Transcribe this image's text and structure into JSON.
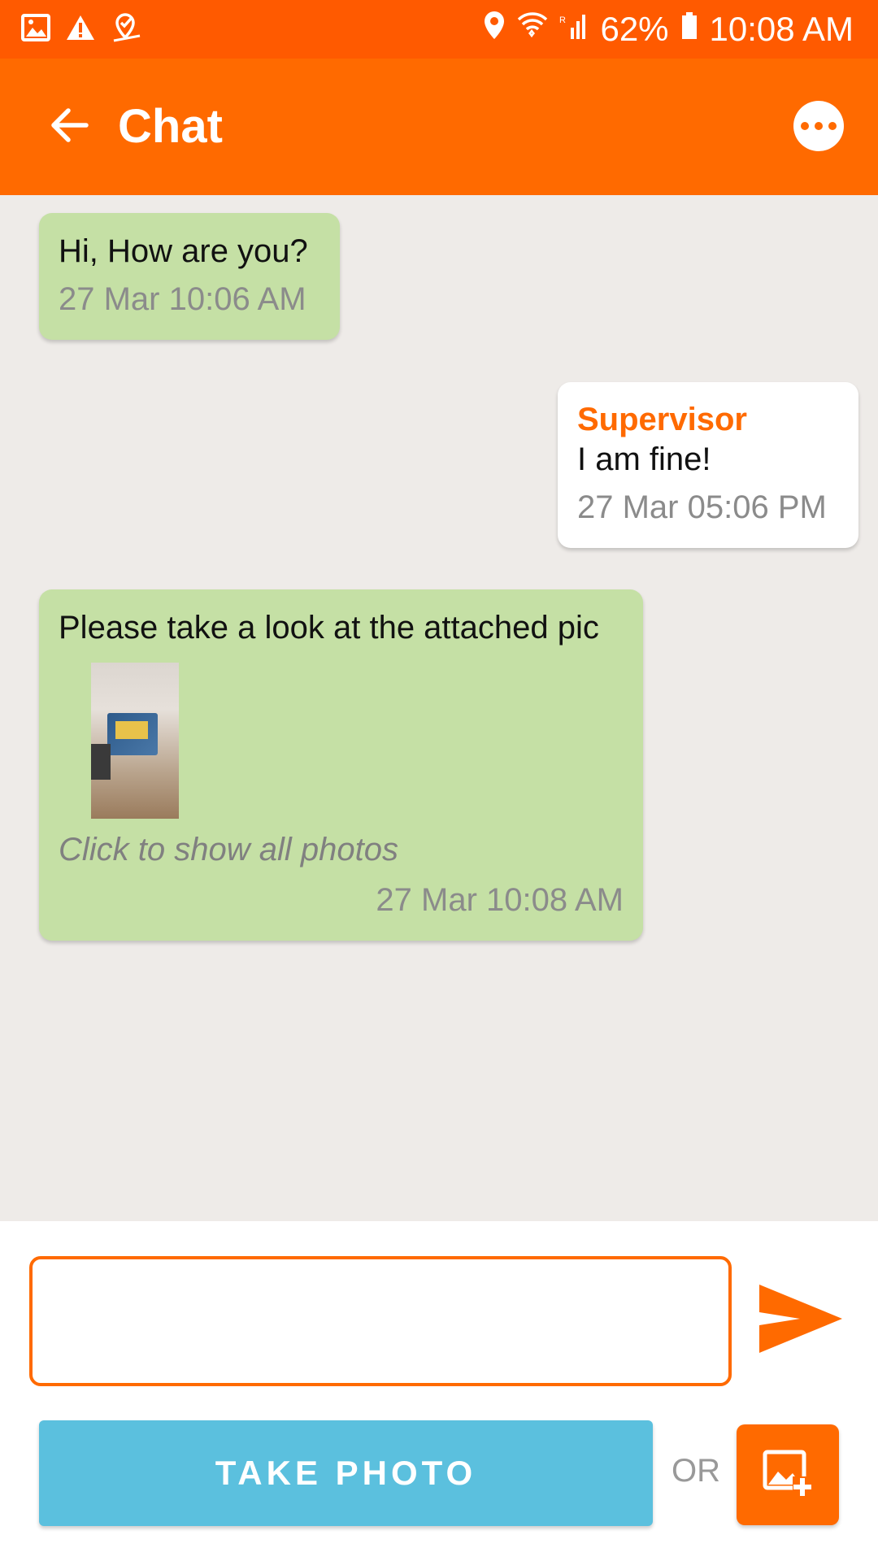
{
  "status_bar": {
    "battery": "62%",
    "time": "10:08 AM",
    "icons": [
      "image-icon",
      "warning-icon",
      "location-check-icon",
      "location-icon",
      "wifi-icon",
      "signal-icon",
      "battery-icon"
    ]
  },
  "app_bar": {
    "title": "Chat",
    "icons": [
      "back-arrow-icon",
      "more-options-icon"
    ]
  },
  "messages": [
    {
      "direction": "incoming",
      "text": "Hi, How are you?",
      "time": "27 Mar 10:06 AM"
    },
    {
      "direction": "outgoing",
      "sender": "Supervisor",
      "text": "I am fine!",
      "time": "27 Mar 05:06 PM"
    },
    {
      "direction": "incoming",
      "text": "Please take a look at the attached pic",
      "photos_link": "Click to show all photos",
      "time": "27 Mar 10:08 AM"
    }
  ],
  "composer": {
    "input_value": "",
    "placeholder": "",
    "take_photo_label": "TAKE PHOTO",
    "or_label": "OR",
    "icons": [
      "send-icon",
      "add-photo-icon"
    ]
  },
  "colors": {
    "status_bar": "#ff5a00",
    "app_bar": "#ff6a00",
    "incoming_bubble": "#c5e0a5",
    "outgoing_bubble": "#ffffff",
    "take_photo_button": "#5bc0de",
    "chat_background": "#eeebe8"
  }
}
